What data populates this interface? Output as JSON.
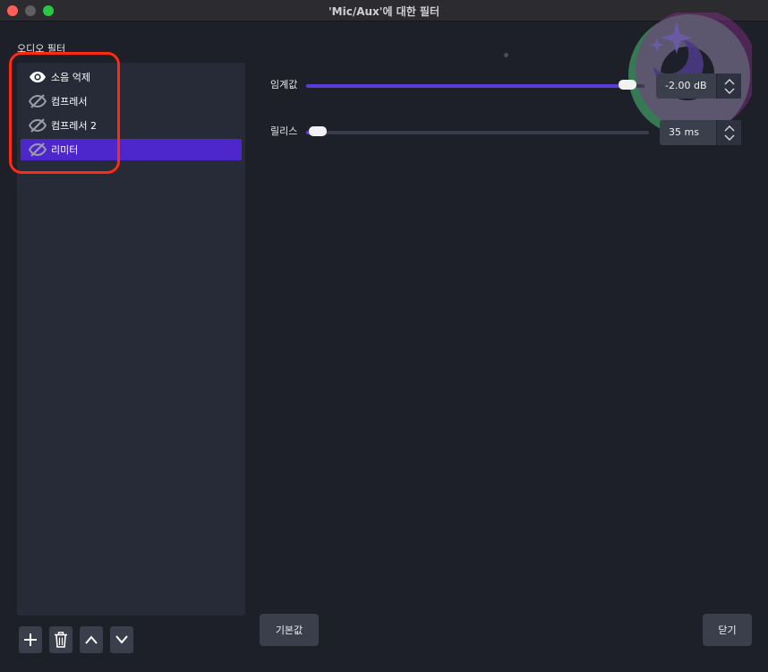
{
  "window": {
    "title": "'Mic/Aux'에 대한 필터"
  },
  "sidebar": {
    "section_label": "오디오 필터",
    "items": [
      {
        "label": "소음 억제",
        "visible": true,
        "selected": false
      },
      {
        "label": "컴프레서",
        "visible": false,
        "selected": false
      },
      {
        "label": "컴프레서 2",
        "visible": false,
        "selected": false
      },
      {
        "label": "리미터",
        "visible": false,
        "selected": true
      }
    ],
    "buttons": [
      "add-icon",
      "trash-icon",
      "chevron-up-icon",
      "chevron-down-icon"
    ]
  },
  "properties": {
    "threshold": {
      "label": "임계값",
      "value_text": "-2.00 dB",
      "value": -2.0,
      "range": [
        -30,
        0
      ],
      "fill_fraction": 0.95
    },
    "release": {
      "label": "릴리스",
      "value_text": "35 ms",
      "value": 35,
      "range": [
        1,
        1000
      ],
      "fill_fraction": 0.034
    }
  },
  "footer": {
    "defaults_label": "기본값",
    "close_label": "닫기"
  },
  "colors": {
    "accent": "#5b3cd8",
    "selected": "#4d27cc",
    "highlight": "#ff2a12",
    "background": "#1d1f29",
    "panel": "#272a37"
  }
}
